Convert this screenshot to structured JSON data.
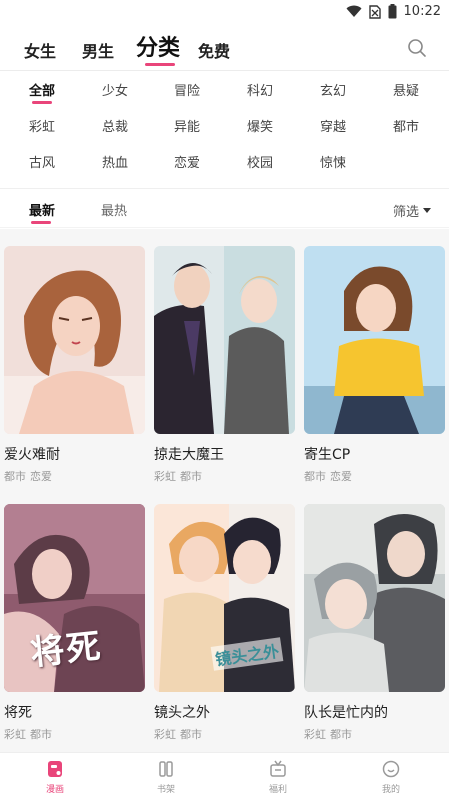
{
  "status_bar": {
    "time": "10:22",
    "icons": [
      "wifi-icon",
      "no-sim-icon",
      "battery-icon"
    ]
  },
  "top_tabs": [
    {
      "label": "女生",
      "active": false
    },
    {
      "label": "男生",
      "active": false
    },
    {
      "label": "分类",
      "active": true
    },
    {
      "label": "免费",
      "active": false
    }
  ],
  "search_icon": "search-icon",
  "categories": [
    {
      "label": "全部",
      "active": true
    },
    {
      "label": "少女",
      "active": false
    },
    {
      "label": "冒险",
      "active": false
    },
    {
      "label": "科幻",
      "active": false
    },
    {
      "label": "玄幻",
      "active": false
    },
    {
      "label": "悬疑",
      "active": false
    },
    {
      "label": "彩虹",
      "active": false
    },
    {
      "label": "总裁",
      "active": false
    },
    {
      "label": "异能",
      "active": false
    },
    {
      "label": "爆笑",
      "active": false
    },
    {
      "label": "穿越",
      "active": false
    },
    {
      "label": "都市",
      "active": false
    },
    {
      "label": "古风",
      "active": false
    },
    {
      "label": "热血",
      "active": false
    },
    {
      "label": "恋爱",
      "active": false
    },
    {
      "label": "校园",
      "active": false
    },
    {
      "label": "惊悚",
      "active": false
    }
  ],
  "sort": {
    "options": [
      {
        "label": "最新",
        "active": true
      },
      {
        "label": "最热",
        "active": false
      }
    ],
    "filter_label": "筛选",
    "filter_icon": "caret-down-icon"
  },
  "comics": [
    {
      "title": "爱火难耐",
      "tags": [
        "都市",
        "恋爱"
      ]
    },
    {
      "title": "掠走大魔王",
      "tags": [
        "彩虹",
        "都市"
      ]
    },
    {
      "title": "寄生CP",
      "tags": [
        "都市",
        "恋爱"
      ]
    },
    {
      "title": "将死",
      "tags": [
        "彩虹",
        "都市"
      ],
      "cover_text": "将死"
    },
    {
      "title": "镜头之外",
      "tags": [
        "彩虹",
        "都市"
      ],
      "cover_text": "镜头之外"
    },
    {
      "title": "队长是忙内的",
      "tags": [
        "彩虹",
        "都市"
      ]
    }
  ],
  "bottom_nav": [
    {
      "label": "漫画",
      "icon": "comic-icon",
      "active": true
    },
    {
      "label": "书架",
      "icon": "bookshelf-icon",
      "active": false
    },
    {
      "label": "福利",
      "icon": "gift-icon",
      "active": false
    },
    {
      "label": "我的",
      "icon": "profile-icon",
      "active": false
    }
  ],
  "colors": {
    "accent": "#e9457a",
    "text": "#222222",
    "muted": "#999999"
  }
}
